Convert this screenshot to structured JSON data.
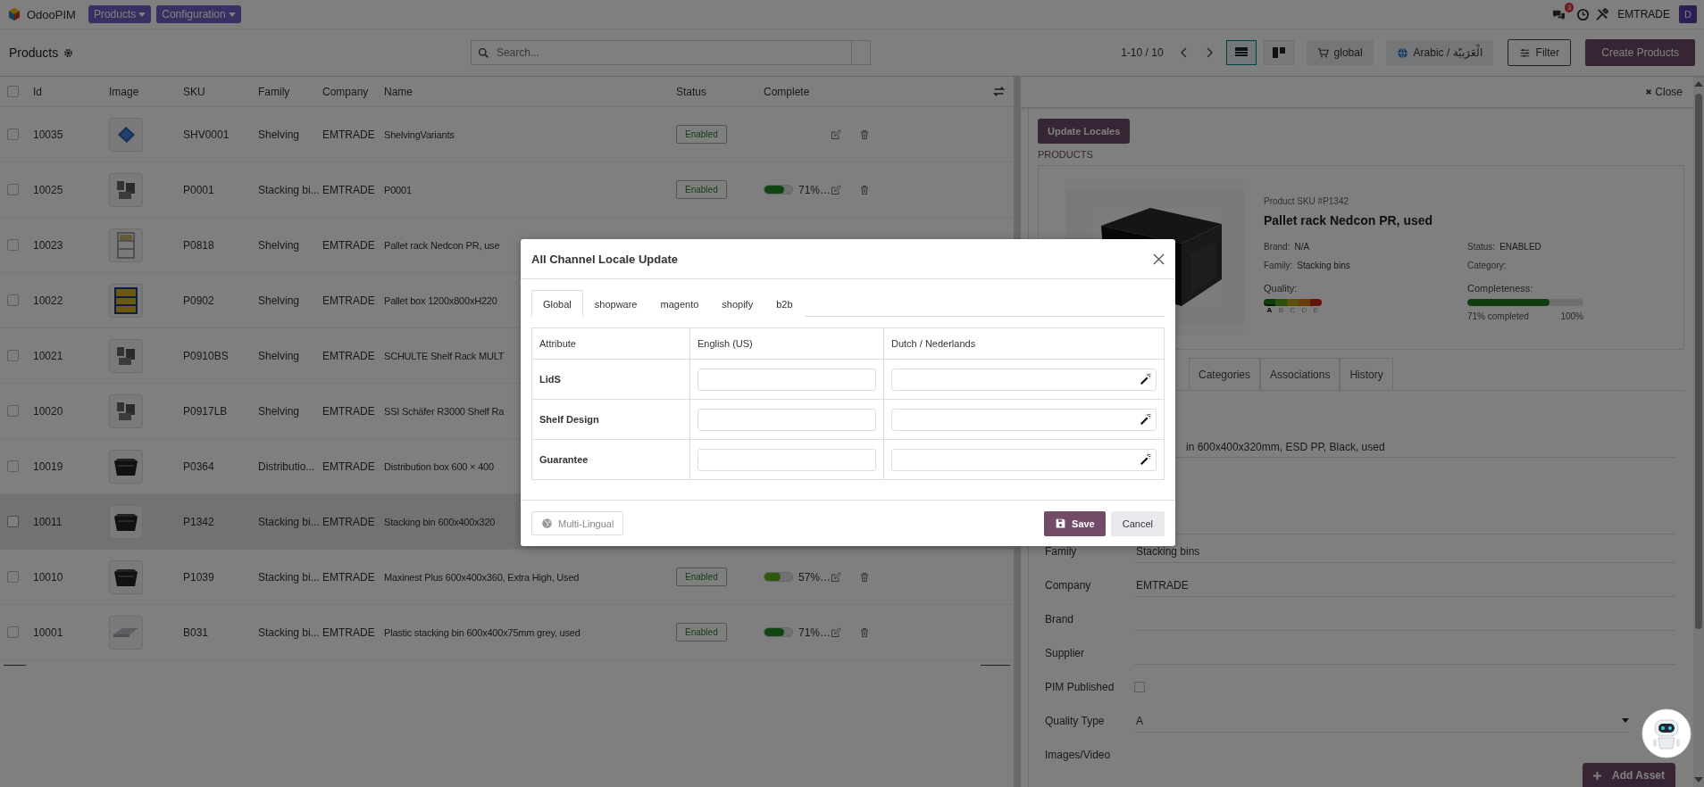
{
  "navbar": {
    "app_name": "OdooPIM",
    "menus": [
      {
        "label": "Products"
      },
      {
        "label": "Configuration"
      }
    ],
    "notification_count": "3",
    "company": "EMTRADE",
    "avatar": "D"
  },
  "control_bar": {
    "title": "Products",
    "search": {
      "placeholder": "Search..."
    },
    "pager": "1-10 / 10",
    "views": [
      {
        "kind": "list",
        "selected": true
      },
      {
        "kind": "kanban",
        "selected": false
      }
    ],
    "scope": "global",
    "language": "Arabic / الْعَرَبيّة",
    "filter": "Filter",
    "create": "Create Products"
  },
  "table": {
    "select_all": {
      "checked": false
    },
    "columns": [
      "Id",
      "Image",
      "SKU",
      "Family",
      "Company",
      "Name",
      "Status",
      "Complete"
    ],
    "rows": [
      {
        "id": "10035",
        "sku": "SHV0001",
        "family": "Shelving",
        "company": "EMTRADE",
        "name": "ShelvingVariants",
        "status": "Enabled",
        "selected": false
      },
      {
        "id": "10025",
        "sku": "P0001",
        "family": "Stacking bi...",
        "company": "EMTRADE",
        "name": "P0001",
        "status": "Enabled",
        "complete": "71%…",
        "level": 0.71,
        "selected": false
      },
      {
        "id": "10023",
        "sku": "P0818",
        "family": "Shelving",
        "company": "EMTRADE",
        "name": "Pallet rack Nedcon PR, use",
        "selected": false
      },
      {
        "id": "10022",
        "sku": "P0902",
        "family": "Shelving",
        "company": "EMTRADE",
        "name": "Pallet box 1200x800xH220",
        "selected": false
      },
      {
        "id": "10021",
        "sku": "P0910BS",
        "family": "Shelving",
        "company": "EMTRADE",
        "name": "SCHULTE Shelf Rack MULT",
        "selected": false
      },
      {
        "id": "10020",
        "sku": "P0917LB",
        "family": "Shelving",
        "company": "EMTRADE",
        "name": "SSI Schäfer R3000 Shelf Ra",
        "selected": false
      },
      {
        "id": "10019",
        "sku": "P0364",
        "family": "Distributio...",
        "company": "EMTRADE",
        "name": "Distribution box 600 × 400",
        "selected": false
      },
      {
        "id": "10011",
        "sku": "P1342",
        "family": "Stacking bi...",
        "company": "EMTRADE",
        "name": "Stacking bin 600x400x320",
        "selected": true
      },
      {
        "id": "10010",
        "sku": "P1039",
        "family": "Stacking bi...",
        "company": "EMTRADE",
        "name": "Maxinest Plus 600x400x360, Extra High, Used",
        "status": "Enabled",
        "complete": "57%…",
        "level": 0.57,
        "selected": false
      },
      {
        "id": "10001",
        "sku": "B031",
        "family": "Stacking bi...",
        "company": "EMTRADE",
        "name": "Plastic stacking bin 600x400x75mm grey, used",
        "status": "Enabled",
        "complete": "71%…",
        "level": 0.71,
        "selected": false
      }
    ]
  },
  "detail": {
    "close": "Close",
    "update_locales": "Update Locales",
    "section": "PRODUCTS",
    "card": {
      "sku": "Product SKU #P1342",
      "title": "Pallet rack Nedcon PR, used",
      "facts": [
        {
          "label": "Brand:",
          "value": "N/A"
        },
        {
          "label": "Status:",
          "value": "ENABLED"
        },
        {
          "label": "Family:",
          "value": "Stacking bins"
        },
        {
          "label": "Category:"
        }
      ],
      "quality": {
        "label": "Quality:",
        "grades": [
          {
            "letter": "A",
            "selected": true
          },
          {
            "letter": "B",
            "selected": false
          },
          {
            "letter": "C",
            "selected": false
          },
          {
            "letter": "D",
            "selected": false
          },
          {
            "letter": "E",
            "selected": false
          }
        ]
      },
      "completeness": {
        "label": "Completeness:",
        "level": 0.71,
        "caption": "71% completed",
        "max": "100%"
      }
    },
    "tabs": [
      {
        "label": "Categories",
        "selected": false
      },
      {
        "label": "Associations",
        "selected": false
      },
      {
        "label": "History",
        "selected": false
      }
    ],
    "description": "in 600x400x320mm, ESD PP, Black, used",
    "fields": [
      {
        "kind": "text",
        "label": "Family",
        "value": "Stacking bins"
      },
      {
        "kind": "text",
        "label": "Company",
        "value": "EMTRADE"
      },
      {
        "kind": "text",
        "label": "Brand"
      },
      {
        "kind": "text",
        "label": "Supplier"
      },
      {
        "kind": "checkbox",
        "label": "PIM Published",
        "checked": false
      },
      {
        "kind": "select",
        "label": "Quality Type",
        "value": "A"
      },
      {
        "kind": "media",
        "label": "Images/Video"
      }
    ],
    "add_asset": "Add Asset"
  },
  "modal": {
    "title": "All Channel Locale Update",
    "tabs": [
      {
        "label": "Global",
        "selected": true
      },
      {
        "label": "shopware",
        "selected": false
      },
      {
        "label": "magento",
        "selected": false
      },
      {
        "label": "shopify",
        "selected": false
      },
      {
        "label": "b2b",
        "selected": false
      }
    ],
    "columns": [
      "Attribute",
      "English (US)",
      "Dutch / Nederlands"
    ],
    "rows": [
      {
        "attribute": "LidS"
      },
      {
        "attribute": "Shelf Design"
      },
      {
        "attribute": "Guarantee"
      }
    ],
    "multilingual": "Multi-Lingual",
    "save": "Save",
    "cancel": "Cancel"
  }
}
